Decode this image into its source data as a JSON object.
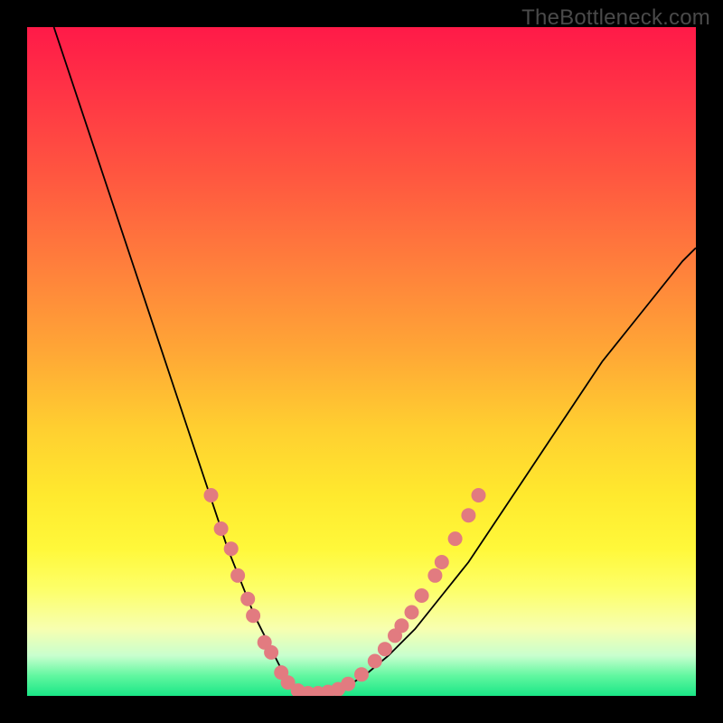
{
  "watermark": "TheBottleneck.com",
  "chart_data": {
    "type": "line",
    "title": "",
    "xlabel": "",
    "ylabel": "",
    "xlim": [
      0,
      100
    ],
    "ylim": [
      0,
      100
    ],
    "background_gradient": {
      "top": "#ff1a48",
      "mid": "#ffe92e",
      "bottom": "#1ae686"
    },
    "curve": {
      "x": [
        4,
        6,
        8,
        10,
        12,
        14,
        16,
        18,
        20,
        22,
        24,
        26,
        28,
        30,
        32,
        34,
        36,
        38,
        39,
        40,
        41,
        42,
        45,
        48,
        51,
        54,
        58,
        62,
        66,
        70,
        74,
        78,
        82,
        86,
        90,
        94,
        98,
        100
      ],
      "y": [
        100,
        94,
        88,
        82,
        76,
        70,
        64,
        58,
        52,
        46,
        40,
        34,
        28,
        22,
        17,
        12,
        8,
        4,
        2,
        0.5,
        0.2,
        0.2,
        0.5,
        1.5,
        3.5,
        6,
        10,
        15,
        20,
        26,
        32,
        38,
        44,
        50,
        55,
        60,
        65,
        67
      ]
    },
    "markers": {
      "color": "#e27b80",
      "radius_px": 8,
      "points": [
        {
          "x": 27.5,
          "y": 30
        },
        {
          "x": 29.0,
          "y": 25
        },
        {
          "x": 30.5,
          "y": 22
        },
        {
          "x": 31.5,
          "y": 18
        },
        {
          "x": 33.0,
          "y": 14.5
        },
        {
          "x": 33.8,
          "y": 12
        },
        {
          "x": 35.5,
          "y": 8
        },
        {
          "x": 36.5,
          "y": 6.5
        },
        {
          "x": 38.0,
          "y": 3.5
        },
        {
          "x": 39.0,
          "y": 2.0
        },
        {
          "x": 40.5,
          "y": 0.8
        },
        {
          "x": 42.0,
          "y": 0.4
        },
        {
          "x": 43.5,
          "y": 0.4
        },
        {
          "x": 45.0,
          "y": 0.6
        },
        {
          "x": 46.5,
          "y": 1.0
        },
        {
          "x": 48.0,
          "y": 1.8
        },
        {
          "x": 50.0,
          "y": 3.2
        },
        {
          "x": 52.0,
          "y": 5.2
        },
        {
          "x": 53.5,
          "y": 7.0
        },
        {
          "x": 55.0,
          "y": 9.0
        },
        {
          "x": 56.0,
          "y": 10.5
        },
        {
          "x": 57.5,
          "y": 12.5
        },
        {
          "x": 59.0,
          "y": 15.0
        },
        {
          "x": 61.0,
          "y": 18.0
        },
        {
          "x": 62.0,
          "y": 20.0
        },
        {
          "x": 64.0,
          "y": 23.5
        },
        {
          "x": 66.0,
          "y": 27.0
        },
        {
          "x": 67.5,
          "y": 30.0
        }
      ]
    }
  }
}
